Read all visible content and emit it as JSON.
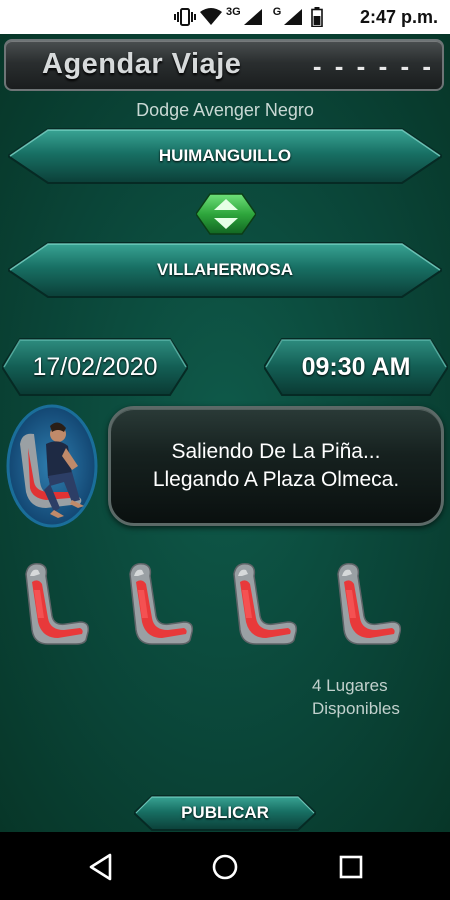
{
  "status_bar": {
    "icons": [
      "vibrate-icon",
      "wifi-icon",
      "signal-icon",
      "signal-icon",
      "battery-icon"
    ],
    "network_1": "3G",
    "network_2": "G",
    "time": "2:47 p.m."
  },
  "header": {
    "title": "Agendar Viaje",
    "menu_glyph": "- - - - - -"
  },
  "vehicle": "Dodge Avenger Negro",
  "route": {
    "origin": "HUIMANGUILLO",
    "destination": "VILLAHERMOSA",
    "swap_icon": "swap-arrows-icon"
  },
  "schedule": {
    "date": "17/02/2020",
    "time": "09:30 AM"
  },
  "trip_status": {
    "line1": "Saliendo De La Piña...",
    "line2": "Llegando A Plaza Olmeca."
  },
  "seats": {
    "count_icons": 4,
    "available_line1": "4 Lugares",
    "available_line2": "Disponibles"
  },
  "actions": {
    "publish": "PUBLICAR"
  },
  "nav": {
    "back": "back-icon",
    "home": "home-icon",
    "recents": "recents-icon"
  },
  "colors": {
    "background": "#0b4a3e",
    "banner": "#1a7a6e",
    "seat_red": "#e8393a",
    "swap_green": "#3fbf4f"
  }
}
